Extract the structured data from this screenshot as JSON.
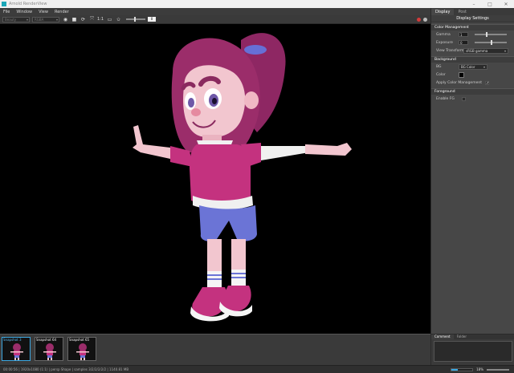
{
  "window": {
    "title": "Arnold RenderView"
  },
  "menu": [
    "File",
    "Window",
    "View",
    "Render"
  ],
  "toolbar": {
    "camera_select": "Beauty",
    "aov_select": "RGBA",
    "ratio_label": "1:1",
    "exposure_value": "0"
  },
  "snapshots": [
    {
      "label": "Snapshot 3",
      "active": true
    },
    {
      "label": "Snapshot 64",
      "active": false
    },
    {
      "label": "Snapshot 65",
      "active": false
    }
  ],
  "status": {
    "text": "00:00:56 | 1920x1080 (1:1) | persp Shape | samples 3/2/2/2/2/2 | 1140.81 MB",
    "progress": 0.3,
    "zoom": "18%"
  },
  "panel": {
    "tabs": [
      "Display",
      "Post"
    ],
    "header": "Display Settings",
    "color_management": {
      "title": "Color Management",
      "gamma_label": "Gamma",
      "gamma_value": "1",
      "exposure_label": "Exposure",
      "exposure_value": "0",
      "view_transform_label": "View Transform",
      "view_transform_value": "sRGB gamma"
    },
    "background": {
      "title": "Background",
      "bg_label": "BG",
      "bg_value": "BG Color",
      "color_label": "Color",
      "apply_cm_label": "Apply Color Management"
    },
    "foreground": {
      "title": "Foreground",
      "enable_fg_label": "Enable FG"
    },
    "comment_tabs": [
      "Comment",
      "Folder"
    ]
  },
  "colors": {
    "accent": "#3ca7e0",
    "viewport_bg": "#000000",
    "shirt": "#c4327f",
    "hair": "#9b2d6a",
    "shorts": "#6b74d6",
    "skin": "#f2c6cf"
  },
  "icons": [
    "render-icon",
    "stop-icon",
    "refresh-icon",
    "region-icon",
    "star-icon",
    "record-icon",
    "settings-icon"
  ]
}
